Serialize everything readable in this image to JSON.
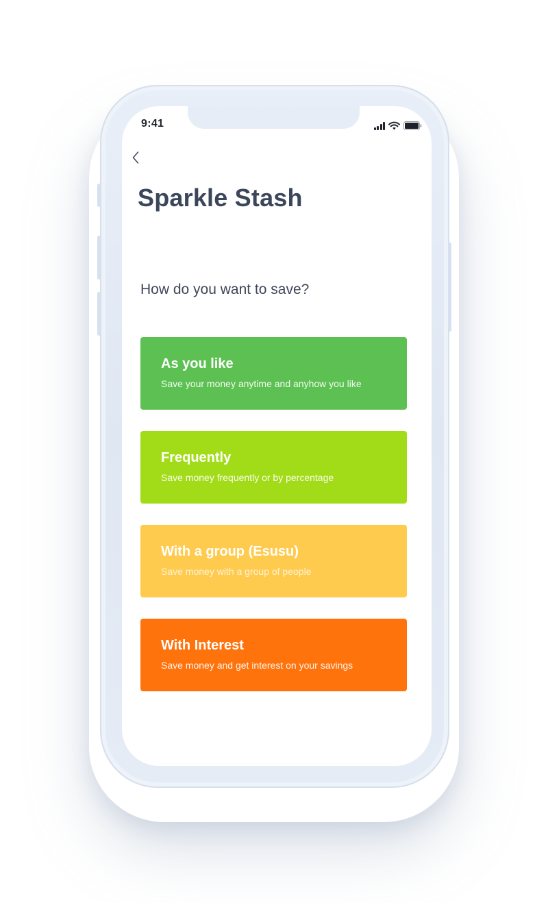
{
  "status_bar": {
    "time": "9:41",
    "icons": [
      "signal-icon",
      "wifi-icon",
      "battery-icon"
    ]
  },
  "header": {
    "back_icon": "chevron-left-icon",
    "title": "Sparkle Stash"
  },
  "main": {
    "question": "How do you want to save?",
    "options": [
      {
        "title": "As you like",
        "description": "Save your money anytime and anyhow you like",
        "color": "#5cc152"
      },
      {
        "title": "Frequently",
        "description": "Save money frequently or by percentage",
        "color": "#a2dc19"
      },
      {
        "title": "With a group (Esusu)",
        "description": "Save money with a group of people",
        "color": "#ffcb4f"
      },
      {
        "title": "With Interest",
        "description": "Save money and get interest on your savings",
        "color": "#ff730d"
      }
    ]
  },
  "colors": {
    "title_text": "#3c465a",
    "phone_frame": "#e3eaf5"
  }
}
